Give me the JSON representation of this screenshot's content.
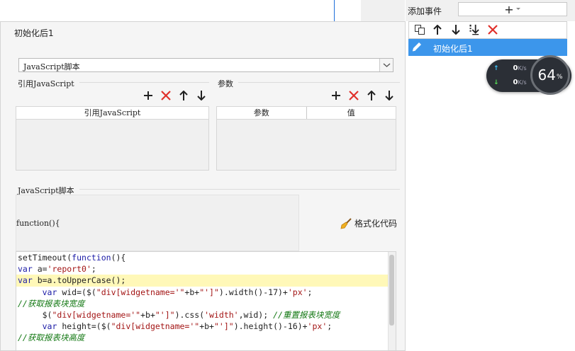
{
  "dialog": {
    "title": "初始化后1",
    "script_type": "JavaScript脚本",
    "ref_section_title": "引用JavaScript",
    "param_section_title": "参数",
    "ref_grid_headers": [
      "引用JavaScript"
    ],
    "param_grid_headers": [
      "参数",
      "值"
    ],
    "script_section_title": "JavaScript脚本",
    "function_header": "function(){",
    "format_button": "格式化代码"
  },
  "code_lines": [
    [
      {
        "t": "setTimeout(",
        "c": ""
      },
      {
        "t": "function",
        "c": "kw"
      },
      {
        "t": "(){",
        "c": ""
      }
    ],
    [
      {
        "t": "var",
        "c": "kw"
      },
      {
        "t": " a=",
        "c": ""
      },
      {
        "t": "'report0'",
        "c": "str"
      },
      {
        "t": ";",
        "c": ""
      }
    ],
    [
      {
        "t": "var",
        "c": "kw"
      },
      {
        "t": " b=a.toUpperCase();",
        "c": ""
      }
    ],
    [
      {
        "t": "     ",
        "c": ""
      },
      {
        "t": "var",
        "c": "kw"
      },
      {
        "t": " wid=($(",
        "c": ""
      },
      {
        "t": "\"div[widgetname='\"",
        "c": "str"
      },
      {
        "t": "+b+",
        "c": ""
      },
      {
        "t": "\"']\"",
        "c": "str"
      },
      {
        "t": ").width()-17)+",
        "c": ""
      },
      {
        "t": "'px'",
        "c": "str"
      },
      {
        "t": ";",
        "c": ""
      }
    ],
    [
      {
        "t": "//获取报表块宽度",
        "c": "cm"
      }
    ],
    [
      {
        "t": "     $(",
        "c": ""
      },
      {
        "t": "\"div[widgetname='\"",
        "c": "str"
      },
      {
        "t": "+b+",
        "c": ""
      },
      {
        "t": "\"']\"",
        "c": "str"
      },
      {
        "t": ").css(",
        "c": ""
      },
      {
        "t": "'width'",
        "c": "str"
      },
      {
        "t": ",wid); ",
        "c": ""
      },
      {
        "t": "//重置报表块宽度",
        "c": "cm"
      }
    ],
    [
      {
        "t": "     ",
        "c": ""
      },
      {
        "t": "var",
        "c": "kw"
      },
      {
        "t": " height=($(",
        "c": ""
      },
      {
        "t": "\"div[widgetname='\"",
        "c": "str"
      },
      {
        "t": "+b+",
        "c": ""
      },
      {
        "t": "\"']\"",
        "c": "str"
      },
      {
        "t": ").height()-16)+",
        "c": ""
      },
      {
        "t": "'px'",
        "c": "str"
      },
      {
        "t": ";",
        "c": ""
      }
    ],
    [
      {
        "t": "//获取报表块高度",
        "c": "cm"
      }
    ]
  ],
  "highlighted_line": 2,
  "right_panel": {
    "label": "添加事件",
    "add_button": "+",
    "items": [
      {
        "label": "初始化后1"
      }
    ]
  },
  "network": {
    "upload_value": "0",
    "upload_unit": "K/s",
    "download_value": "0",
    "download_unit": "K/s",
    "percent": "64",
    "percent_sign": "%"
  },
  "colors": {
    "accent": "#3c96eb",
    "delete_red": "#e0302b"
  }
}
